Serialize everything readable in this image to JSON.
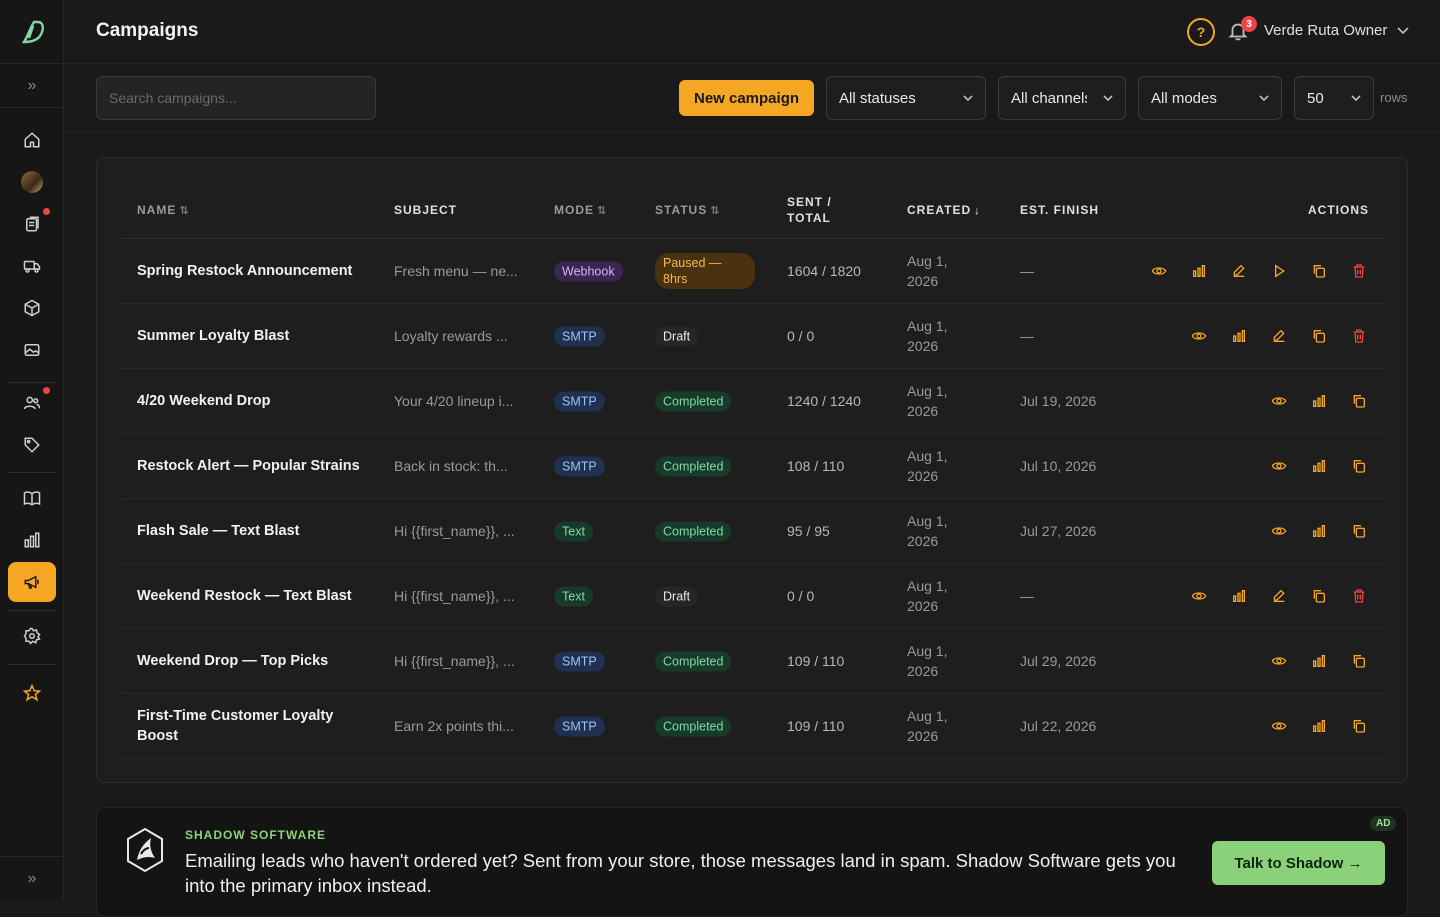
{
  "app": {
    "page_title": "Campaigns"
  },
  "sidebar": {
    "items": [
      {
        "icon": "home-icon"
      },
      {
        "icon": "avatar-icon"
      },
      {
        "icon": "orders-icon",
        "badge": true
      },
      {
        "icon": "delivery-icon"
      },
      {
        "icon": "inventory-icon"
      },
      {
        "icon": "media-icon"
      },
      {
        "icon": "customers-icon",
        "badge": true
      },
      {
        "icon": "tag-icon"
      },
      {
        "icon": "book-icon"
      },
      {
        "icon": "analytics-icon"
      },
      {
        "icon": "megaphone-icon",
        "active": true
      },
      {
        "icon": "gear-icon"
      },
      {
        "icon": "star-icon"
      }
    ]
  },
  "header": {
    "notifications_count": "3",
    "user_label": "Verde Ruta Owner"
  },
  "filters": {
    "search_placeholder": "Search campaigns...",
    "new_campaign_label": "New campaign",
    "status_value": "All statuses",
    "channel_value": "All channels",
    "mode_value": "All modes",
    "rows_value": "50",
    "rows_label": "rows"
  },
  "table": {
    "columns": {
      "name": "Name",
      "subject": "Subject",
      "mode": "Mode",
      "status": "Status",
      "sent_total_1": "Sent /",
      "sent_total_2": "Total",
      "created": "Created",
      "est_finish": "Est. Finish",
      "actions": "Actions"
    },
    "rows": [
      {
        "name": "Spring Restock Announcement",
        "subject": "Fresh menu — ne...",
        "mode": "Webhook",
        "status": "Paused — 8hrs",
        "sent": "1604 / 1820",
        "created": "Aug 1, 2026",
        "finish": "—",
        "actions": [
          "view",
          "stats",
          "edit",
          "resume",
          "copy",
          "delete"
        ]
      },
      {
        "name": "Summer Loyalty Blast",
        "subject": "Loyalty rewards ...",
        "mode": "SMTP",
        "status": "Draft",
        "sent": "0 / 0",
        "created": "Aug 1, 2026",
        "finish": "—",
        "actions": [
          "view",
          "stats",
          "edit",
          "copy",
          "delete"
        ]
      },
      {
        "name": "4/20 Weekend Drop",
        "subject": "Your 4/20 lineup i...",
        "mode": "SMTP",
        "status": "Completed",
        "sent": "1240 / 1240",
        "created": "Aug 1, 2026",
        "finish": "Jul 19, 2026",
        "actions": [
          "view",
          "stats",
          "copy"
        ]
      },
      {
        "name": "Restock Alert — Popular Strains",
        "subject": "Back in stock: th...",
        "mode": "SMTP",
        "status": "Completed",
        "sent": "108 / 110",
        "created": "Aug 1, 2026",
        "finish": "Jul 10, 2026",
        "actions": [
          "view",
          "stats",
          "copy"
        ]
      },
      {
        "name": "Flash Sale — Text Blast",
        "subject": "Hi {{first_name}}, ...",
        "mode": "Text",
        "status": "Completed",
        "sent": "95 / 95",
        "created": "Aug 1, 2026",
        "finish": "Jul 27, 2026",
        "actions": [
          "view",
          "stats",
          "copy"
        ]
      },
      {
        "name": "Weekend Restock — Text Blast",
        "subject": "Hi {{first_name}}, ...",
        "mode": "Text",
        "status": "Draft",
        "sent": "0 / 0",
        "created": "Aug 1, 2026",
        "finish": "—",
        "actions": [
          "view",
          "stats",
          "edit",
          "copy",
          "delete"
        ]
      },
      {
        "name": "Weekend Drop — Top Picks",
        "subject": "Hi {{first_name}}, ...",
        "mode": "SMTP",
        "status": "Completed",
        "sent": "109 / 110",
        "created": "Aug 1, 2026",
        "finish": "Jul 29, 2026",
        "actions": [
          "view",
          "stats",
          "copy"
        ]
      },
      {
        "name": "First-Time Customer Loyalty Boost",
        "subject": "Earn 2x points thi...",
        "mode": "SMTP",
        "status": "Completed",
        "sent": "109 / 110",
        "created": "Aug 1, 2026",
        "finish": "Jul 22, 2026",
        "actions": [
          "view",
          "stats",
          "copy"
        ]
      }
    ]
  },
  "ad": {
    "brand": "SHADOW SOFTWARE",
    "text": "Emailing leads who haven't ordered yet? Sent from your store, those messages land in spam. Shadow Software gets you into the primary inbox instead.",
    "tag": "AD",
    "cta": "Talk to Shadow"
  },
  "colors": {
    "accent": "#f5a623",
    "danger": "#ef4444",
    "ad_green": "#8bd17a"
  }
}
